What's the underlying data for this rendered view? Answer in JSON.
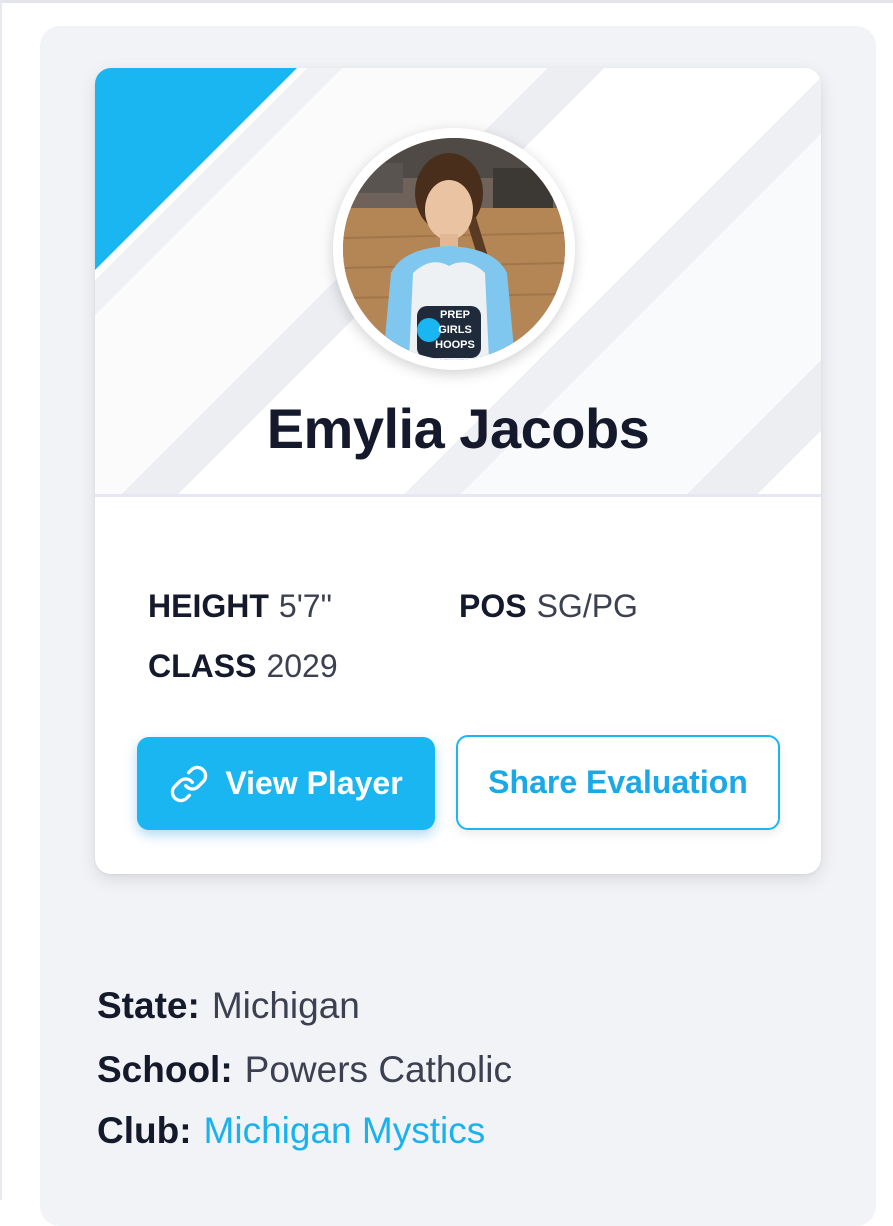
{
  "colors": {
    "accent": "#1ab6f2",
    "text_dark": "#141a2b",
    "text_muted": "#3c4050",
    "panel_bg": "#f2f3f6"
  },
  "player": {
    "name": "Emylia Jacobs",
    "photo_jersey_text": [
      "PREP",
      "GIRLS",
      "HOOPS"
    ]
  },
  "stats": {
    "height": {
      "label": "HEIGHT",
      "value": "5'7\""
    },
    "pos": {
      "label": "POS",
      "value": "SG/PG"
    },
    "class": {
      "label": "CLASS",
      "value": "2029"
    }
  },
  "buttons": {
    "view_player": {
      "label": "View Player",
      "icon": "link-icon"
    },
    "share_evaluation": {
      "label": "Share Evaluation"
    }
  },
  "details": {
    "state": {
      "label": "State:",
      "value": "Michigan"
    },
    "school": {
      "label": "School:",
      "value": "Powers Catholic"
    },
    "club": {
      "label": "Club:",
      "value": "Michigan Mystics"
    }
  }
}
